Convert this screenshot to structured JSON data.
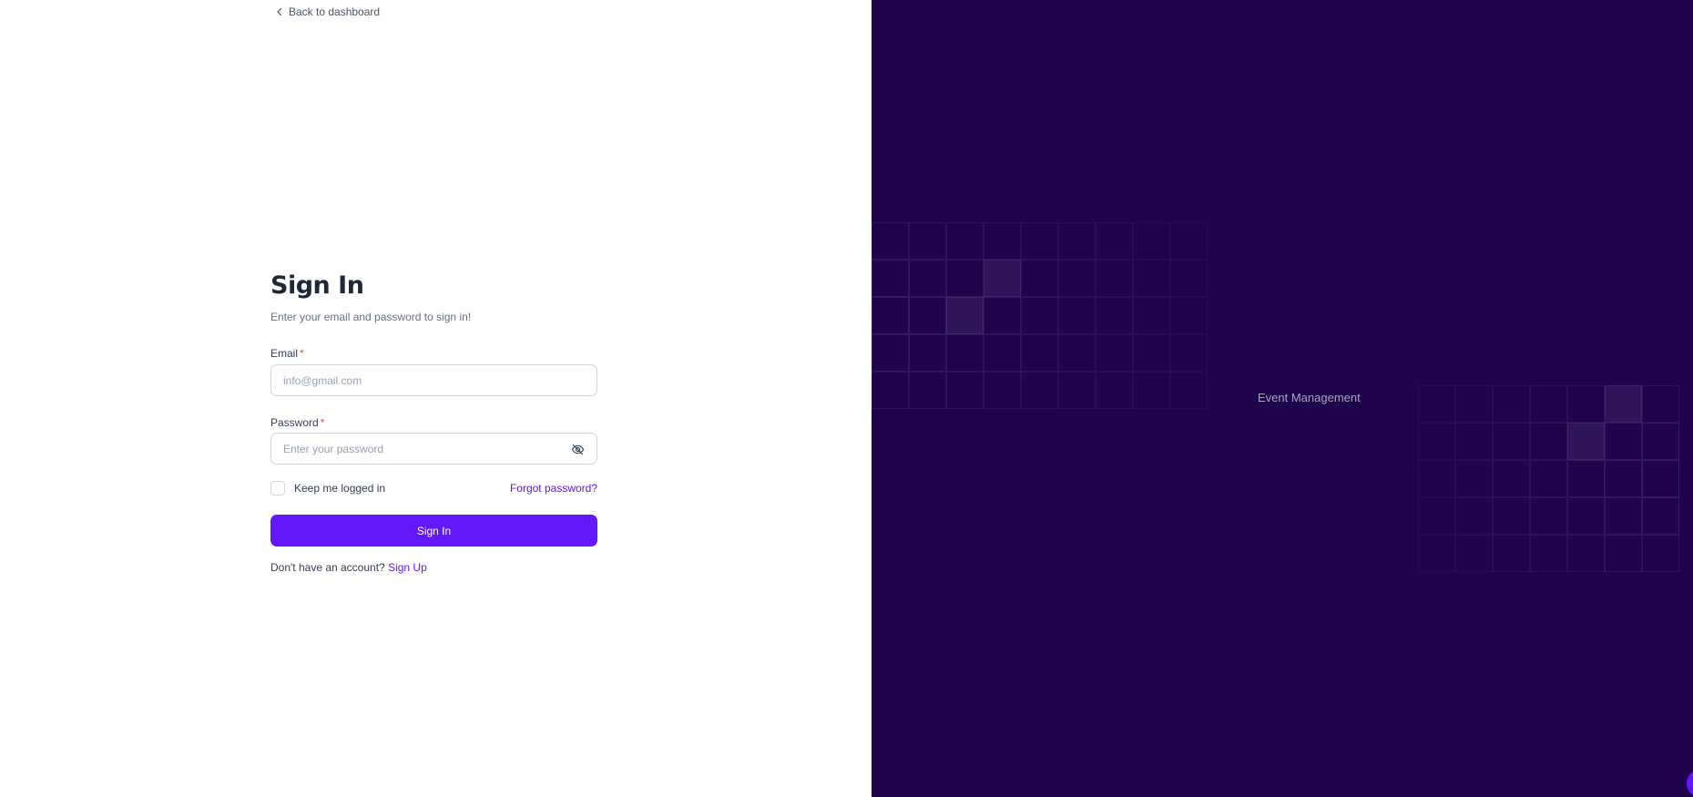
{
  "nav": {
    "back_label": "Back to dashboard"
  },
  "form": {
    "title": "Sign In",
    "subtitle": "Enter your email and password to sign in!",
    "email": {
      "label": "Email",
      "required_mark": "*",
      "placeholder": "info@gmail.com",
      "value": ""
    },
    "password": {
      "label": "Password",
      "required_mark": "*",
      "placeholder": "Enter your password",
      "value": "",
      "toggle_icon": "eye-off-icon"
    },
    "keep_logged_in": {
      "label": "Keep me logged in",
      "checked": false
    },
    "forgot_label": "Forgot password?",
    "submit_label": "Sign In",
    "signup_prompt": "Don't have an account?",
    "signup_label": "Sign Up"
  },
  "brand": {
    "text": "Event Management"
  },
  "colors": {
    "accent": "#6418f7",
    "panel_bg": "#1f044d",
    "required": "#f04438"
  }
}
